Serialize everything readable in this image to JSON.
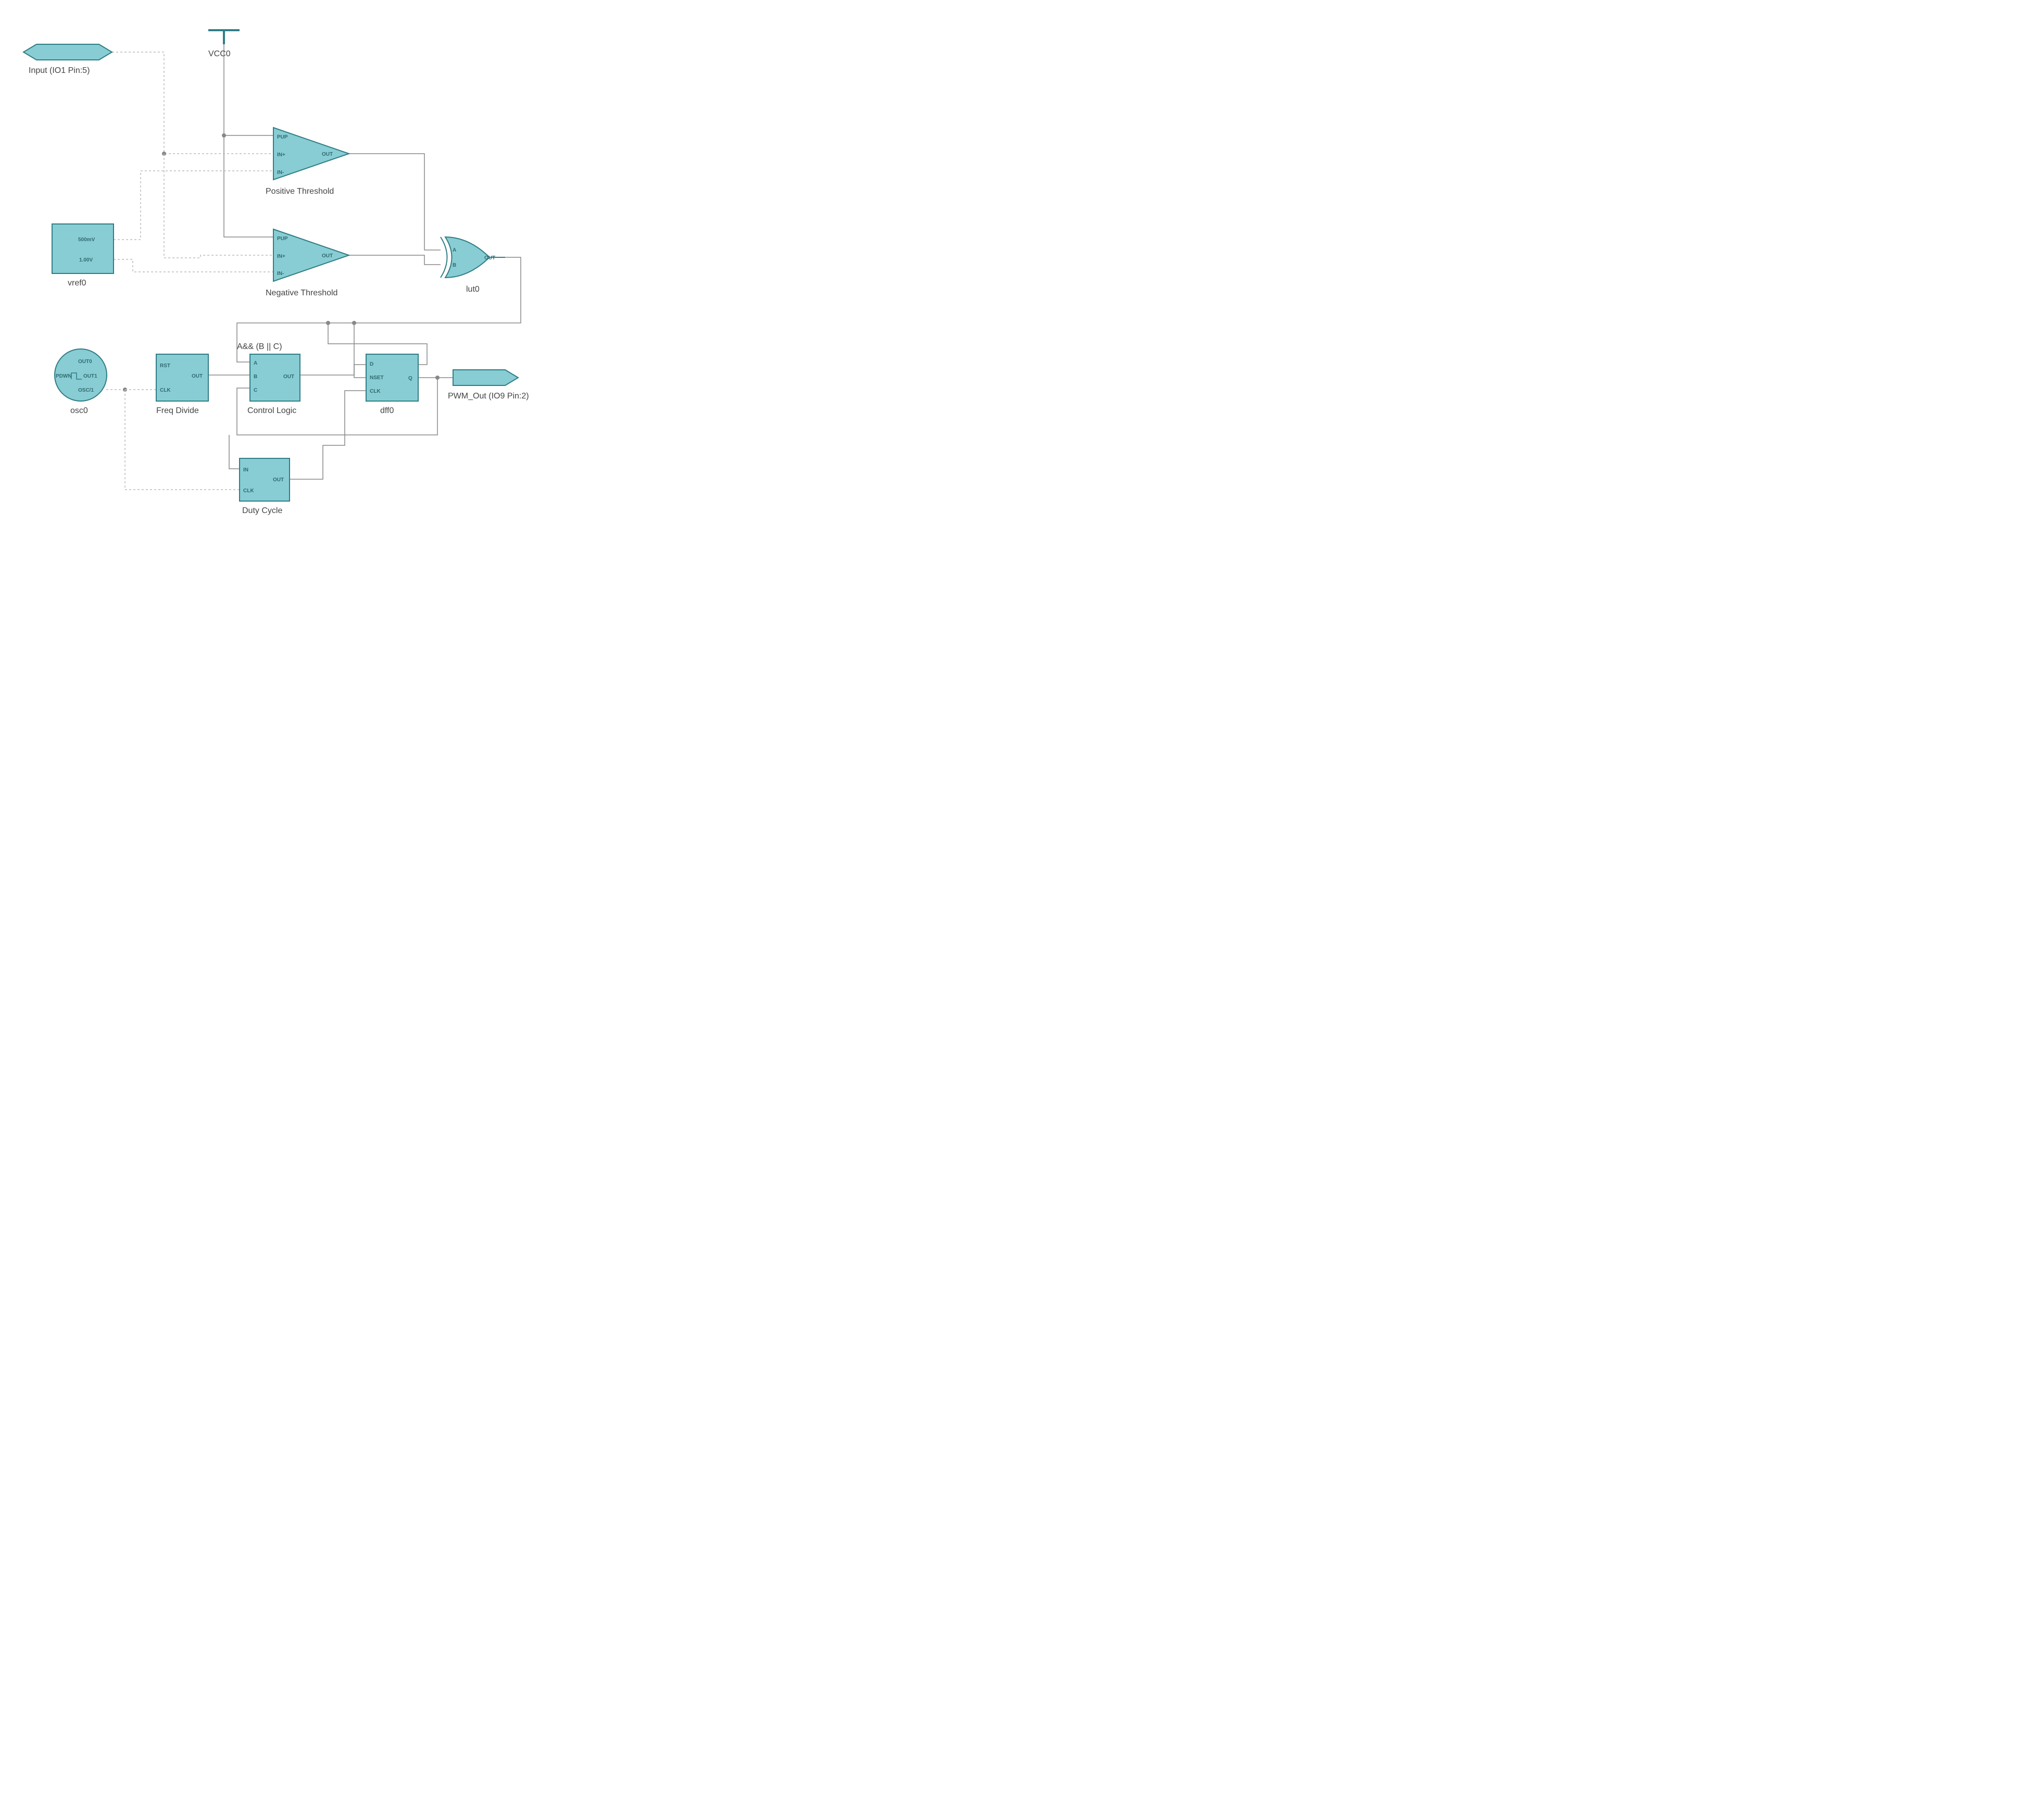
{
  "blocks": {
    "input": {
      "label": "Input (IO1 Pin:5)"
    },
    "vcc": {
      "label": "VCC0"
    },
    "vref": {
      "label": "vref0",
      "v1": "500mV",
      "v2": "1.00V"
    },
    "comp1": {
      "label": "Positive Threshold",
      "pins": {
        "pup": "PUP",
        "inp": "IN+",
        "inn": "IN-",
        "out": "OUT"
      }
    },
    "comp2": {
      "label": "Negative Threshold",
      "pins": {
        "pup": "PUP",
        "inp": "IN+",
        "inn": "IN-",
        "out": "OUT"
      }
    },
    "xor": {
      "label": "lut0",
      "pins": {
        "a": "A",
        "b": "B",
        "out": "OUT"
      }
    },
    "osc": {
      "label": "osc0",
      "pins": {
        "out0": "OUT0",
        "out1": "OUT1",
        "osc": "OSC/1",
        "pdwn": "PDWN"
      }
    },
    "freq": {
      "label": "Freq Divide",
      "pins": {
        "rst": "RST",
        "clk": "CLK",
        "out": "OUT"
      }
    },
    "ctrl": {
      "label": "Control Logic",
      "expr": "A&& (B || C)",
      "pins": {
        "a": "A",
        "b": "B",
        "c": "C",
        "out": "OUT"
      }
    },
    "dff": {
      "label": "dff0",
      "pins": {
        "d": "D",
        "nset": "NSET",
        "clk": "CLK",
        "q": "Q"
      }
    },
    "duty": {
      "label": "Duty Cycle",
      "pins": {
        "inp": "IN",
        "clk": "CLK",
        "out": "OUT"
      }
    },
    "output": {
      "label": "PWM_Out (IO9 Pin:2)"
    }
  }
}
